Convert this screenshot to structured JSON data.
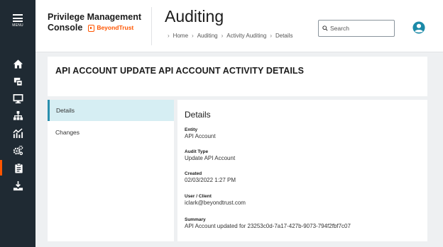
{
  "nav": {
    "menu_label": "MENU",
    "items": [
      {
        "icon": "home-icon"
      },
      {
        "icon": "computer-icon"
      },
      {
        "icon": "monitor-icon"
      },
      {
        "icon": "hierarchy-icon"
      },
      {
        "icon": "analytics-icon"
      },
      {
        "icon": "gears-icon"
      },
      {
        "icon": "clipboard-icon",
        "active": true
      },
      {
        "icon": "download-icon"
      }
    ],
    "accent_color": "#ff5500"
  },
  "header": {
    "brand_line1": "Privilege Management",
    "brand_line2": "Console",
    "logo_text": "BeyondTrust",
    "title": "Auditing",
    "breadcrumb": [
      "Home",
      "Auditing",
      "Activity Auditing",
      "Details"
    ],
    "search_placeholder": "Search"
  },
  "main": {
    "heading": "API ACCOUNT UPDATE API ACCOUNT ACTIVITY DETAILS",
    "tabs": [
      {
        "label": "Details",
        "active": true
      },
      {
        "label": "Changes",
        "active": false
      }
    ],
    "details": {
      "title": "Details",
      "fields": [
        {
          "label": "Entity",
          "value": "API Account"
        },
        {
          "label": "Audit Type",
          "value": "Update API Account"
        },
        {
          "label": "Created",
          "value": "02/03/2022 1:27 PM"
        },
        {
          "label": "User / Client",
          "value": "iclark@beyondtrust.com"
        },
        {
          "label": "Summary",
          "value": "API Account updated for 23253c0d-7a17-427b-9073-794f2fbf7c07"
        }
      ]
    }
  },
  "colors": {
    "nav_bg": "#1f2a33",
    "active_tab_bg": "#d6eef3",
    "active_tab_border": "#2b8fad"
  }
}
